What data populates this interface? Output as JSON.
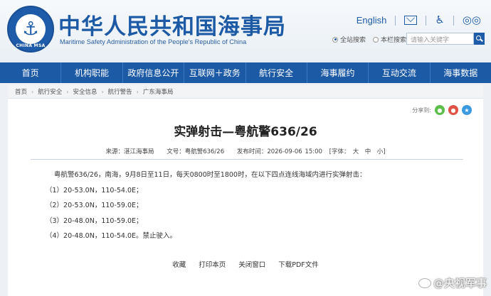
{
  "header": {
    "logo_text": "CHINA MSA",
    "site_title": "中华人民共和国海事局",
    "site_subtitle": "Maritime Safety Administration of the People's Republic of China",
    "lang_link": "English",
    "icons": [
      "mail-icon",
      "accessibility-icon",
      "glasses-icon"
    ],
    "search_scopes": [
      {
        "label": "全站搜索",
        "selected": true
      },
      {
        "label": "本栏搜索",
        "selected": false
      }
    ],
    "search_placeholder": "请输入关键字"
  },
  "nav": {
    "items": [
      "首页",
      "机构职能",
      "政府信息公开",
      "互联网＋政务",
      "航行安全",
      "海事履约",
      "互动交流",
      "海事数据"
    ]
  },
  "breadcrumb": [
    "首页",
    "航行安全",
    "安全信息",
    "航行警告",
    "广东海事局"
  ],
  "share": {
    "label": "分享到:",
    "icons": [
      "wechat-icon",
      "weibo-icon",
      "qzone-icon"
    ]
  },
  "article": {
    "title": "实弹射击—粤航警636/26",
    "meta": {
      "source": "来源：湛江海事局",
      "doc_no": "文号：粤航警636/26",
      "date": "发布时间：2026-09-06 15:00",
      "font_size": "[字体：　大　中　小]"
    },
    "intro": "粤航警636/26，南海，9月8日至11日，每天0800时至1800时，在以下四点连线海域内进行实弹射击：",
    "points": [
      "（1）20-53.0N，110-54.0E；",
      "（2）20-53.0N，110-59.0E；",
      "（3）20-48.0N，110-59.0E；",
      "（4）20-48.0N，110-54.0E。禁止驶入。"
    ]
  },
  "actions": [
    "收藏",
    "打印本页",
    "关闭窗口",
    "下载PDF文件"
  ],
  "watermark": "@央视军事",
  "colors": {
    "brand_blue": "#1c5aa6",
    "page_bg": "#edf1f5",
    "panel_bg": "#ffffff"
  }
}
